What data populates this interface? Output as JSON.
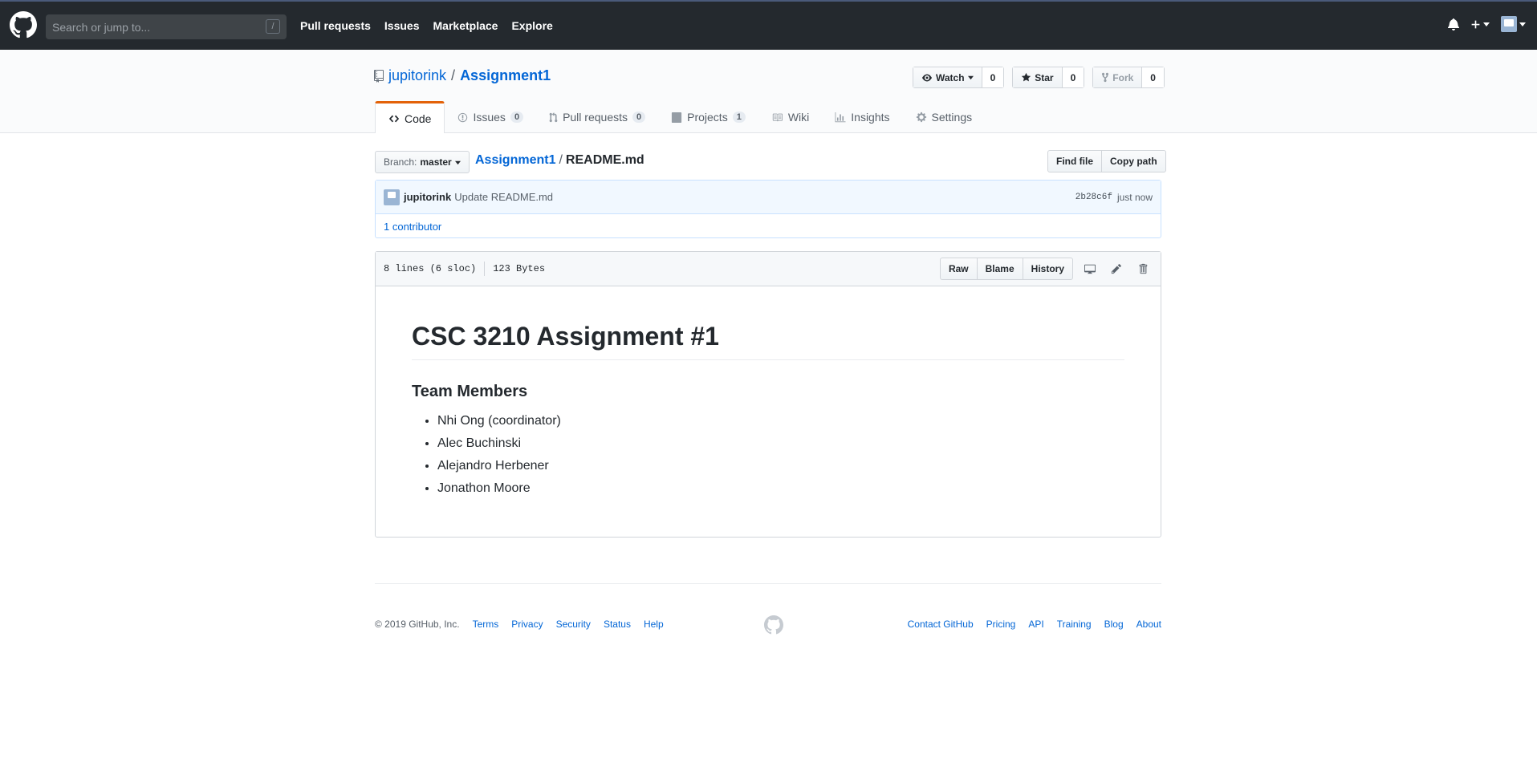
{
  "topbar": {
    "search_placeholder": "Search or jump to...",
    "search_hotkey": "/",
    "nav": [
      "Pull requests",
      "Issues",
      "Marketplace",
      "Explore"
    ],
    "icons": [
      "bell-icon",
      "plus-icon",
      "avatar"
    ]
  },
  "repo": {
    "owner": "jupitorink",
    "separator": "/",
    "name": "Assignment1",
    "watch_label": "Watch",
    "watch_count": "0",
    "star_label": "Star",
    "star_count": "0",
    "fork_label": "Fork",
    "fork_count": "0"
  },
  "tabs": [
    {
      "label": "Code",
      "count": null
    },
    {
      "label": "Issues",
      "count": "0"
    },
    {
      "label": "Pull requests",
      "count": "0"
    },
    {
      "label": "Projects",
      "count": "1"
    },
    {
      "label": "Wiki",
      "count": null
    },
    {
      "label": "Insights",
      "count": null
    },
    {
      "label": "Settings",
      "count": null
    }
  ],
  "file": {
    "branch_prefix": "Branch:",
    "branch": "master",
    "crumb_repo": "Assignment1",
    "crumb_sep": "/",
    "crumb_file": "README.md",
    "find_file": "Find file",
    "copy_path": "Copy path"
  },
  "commit": {
    "author": "jupitorink",
    "message": "Update README.md",
    "sha": "2b28c6f",
    "time": "just now",
    "contributors": "1 contributor"
  },
  "fileinfo": {
    "lines": "8 lines (6 sloc)",
    "size": "123 Bytes",
    "raw": "Raw",
    "blame": "Blame",
    "history": "History"
  },
  "readme": {
    "h1": "CSC 3210 Assignment #1",
    "h2": "Team Members",
    "members": [
      "Nhi Ong (coordinator)",
      "Alec Buchinski",
      "Alejandro Herbener",
      "Jonathon Moore"
    ]
  },
  "footer": {
    "copyright": "© 2019 GitHub, Inc.",
    "left_links": [
      "Terms",
      "Privacy",
      "Security",
      "Status",
      "Help"
    ],
    "right_links": [
      "Contact GitHub",
      "Pricing",
      "API",
      "Training",
      "Blog",
      "About"
    ]
  },
  "colors": {
    "topbar": "#24292e",
    "link": "#0366d6",
    "selected_tab_accent": "#e36209"
  }
}
